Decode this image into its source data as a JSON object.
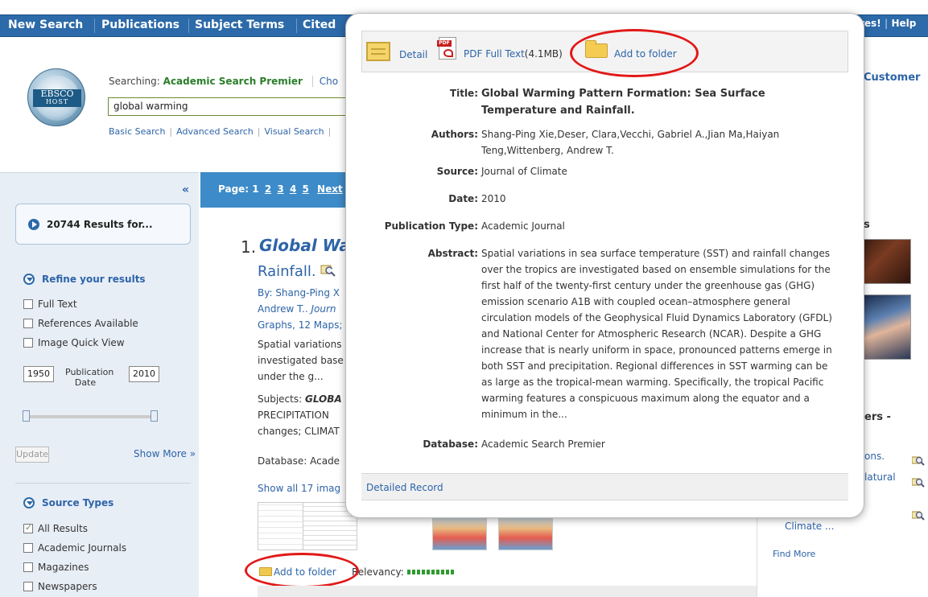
{
  "nav": {
    "items": [
      "New Search",
      "Publications",
      "Subject Terms",
      "Cited"
    ],
    "right_fragment": "res!",
    "help": "Help"
  },
  "logo": {
    "main": "EBSCO",
    "sub": "HOST"
  },
  "search": {
    "searching_label": "Searching:",
    "database": "Academic Search Premier",
    "choose_fragment": "Cho",
    "query": "global warming",
    "links": [
      "Basic Search",
      "Advanced Search",
      "Visual Search"
    ]
  },
  "customer_fragment": "Customer",
  "sidebar": {
    "collapse_symbol": "«",
    "results_count": "20744 Results for...",
    "refine_heading": "Refine your results",
    "refine_options": [
      "Full Text",
      "References Available",
      "Image Quick View"
    ],
    "date_from": "1950",
    "date_label": "Publication Date",
    "date_to": "2010",
    "update_label": "Update",
    "show_more": "Show More »",
    "source_types_heading": "Source Types",
    "source_types": [
      {
        "label": "All Results",
        "checked": true
      },
      {
        "label": "Academic Journals",
        "checked": false
      },
      {
        "label": "Magazines",
        "checked": false
      },
      {
        "label": "Newspapers",
        "checked": false
      }
    ]
  },
  "pager": {
    "label": "Page:",
    "pages": [
      "1",
      "2",
      "3",
      "4",
      "5"
    ],
    "next": "Next"
  },
  "result": {
    "number": "1.",
    "title_fragment": "Global War",
    "title_line2": "Rainfall.",
    "by_line": "By: Shang-Ping X",
    "line2_prefix": "Andrew T..",
    "line2_journal": "Journ",
    "line3": "Graphs, 12 Maps;",
    "abstract_lines": [
      "Spatial variations",
      "investigated base",
      "under the g..."
    ],
    "subjects_prefix": "Subjects:",
    "subjects_term": "GLOBA",
    "subject_line2": "PRECIPITATION",
    "subject_line3": "changes; CLIMAT",
    "database_fragment": "Database: Acade",
    "show_images": "Show all 17 imag",
    "add_to_folder": "Add to folder",
    "relevancy_label": "Relevancy:"
  },
  "right_panel": {
    "fragment_s": "s",
    "fragment_ers": "ers -",
    "item1": "ons.",
    "item2": "latural",
    "item3": "Climate ...",
    "find_more": "Find More"
  },
  "popup": {
    "toolbar": {
      "detail": "Detail",
      "pdf": "PDF Full Text",
      "pdf_size": "(4.1MB)",
      "add_to_folder": "Add to folder"
    },
    "fields": {
      "title_label": "Title:",
      "title": "Global Warming Pattern Formation: Sea Surface Temperature and Rainfall.",
      "authors_label": "Authors:",
      "authors": "Shang-Ping Xie,Deser, Clara,Vecchi, Gabriel A.,Jian Ma,Haiyan Teng,Wittenberg, Andrew T.",
      "source_label": "Source:",
      "source": "Journal of Climate",
      "date_label": "Date:",
      "date": "2010",
      "pubtype_label": "Publication Type:",
      "pubtype": "Academic Journal",
      "abstract_label": "Abstract:",
      "abstract": "Spatial variations in sea surface temperature (SST) and rainfall changes over the tropics are investigated based on ensemble simulations for the first half of the twenty-first century under the greenhouse gas (GHG) emission scenario A1B with coupled ocean–atmosphere general circulation models of the Geophysical Fluid Dynamics Laboratory (GFDL) and National Center for Atmospheric Research (NCAR). Despite a GHG increase that is nearly uniform in space, pronounced patterns emerge in both SST and precipitation. Regional differences in SST warming can be as large as the tropical-mean warming. Specifically, the tropical Pacific warming features a conspicuous maximum along the equator and a minimum in the...",
      "database_label": "Database:",
      "database": "Academic Search Premier"
    },
    "detailed_record": "Detailed Record"
  },
  "colors": {
    "nav_blue": "#2c6aa9",
    "link_blue": "#2d64a8",
    "highlight_red": "#e21818",
    "relevancy_green": "#2f9a2f"
  }
}
